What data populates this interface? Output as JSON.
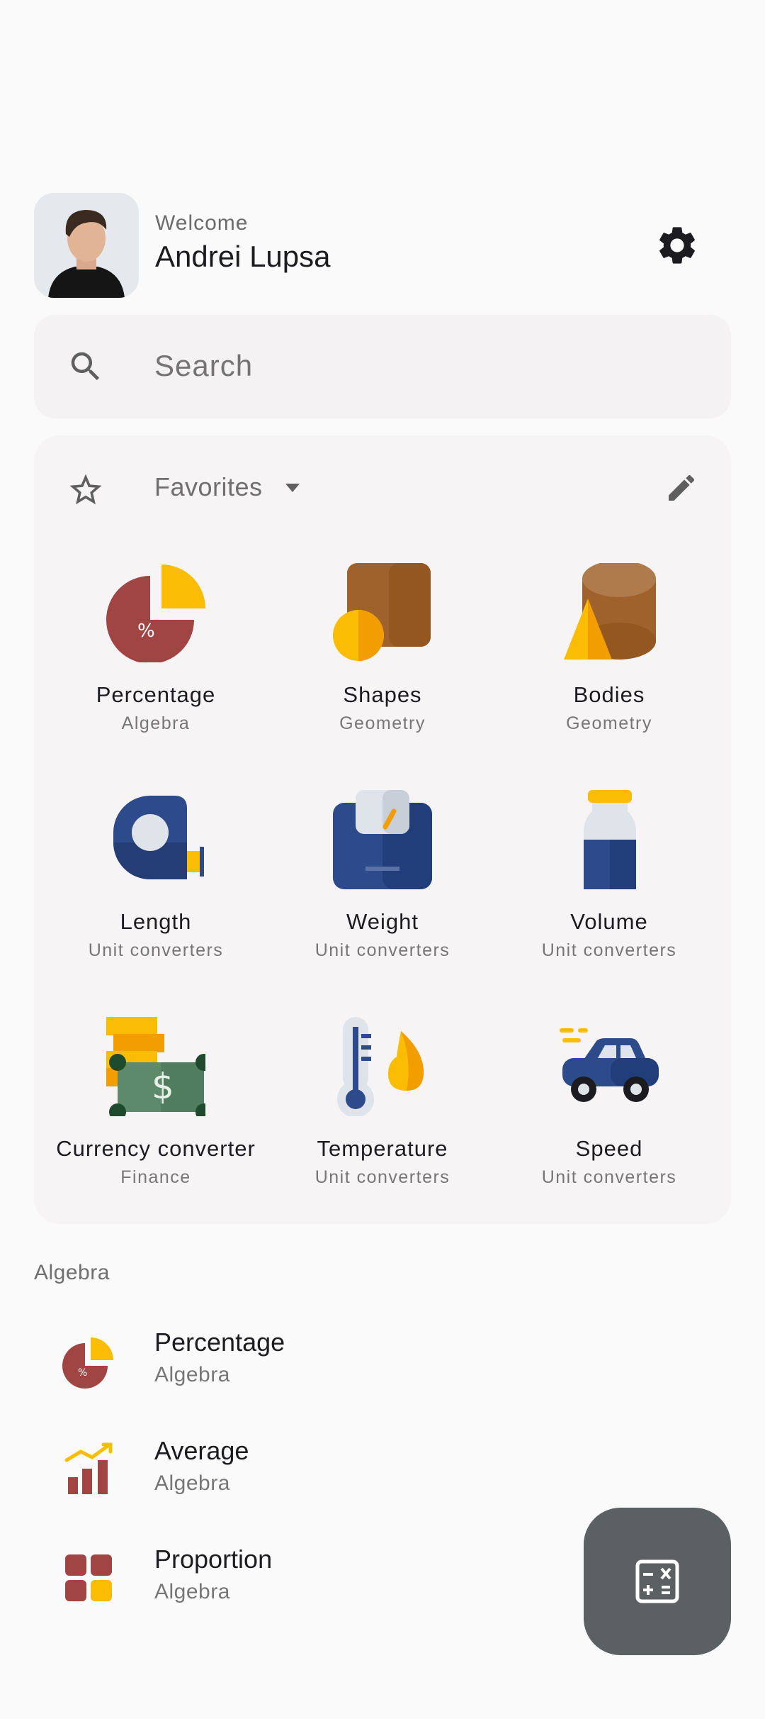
{
  "header": {
    "welcome": "Welcome",
    "user_name": "Andrei Lupsa",
    "avatar_icon": "user-avatar-photo",
    "settings_icon": "gear-icon"
  },
  "search": {
    "placeholder": "Search",
    "icon": "search-icon"
  },
  "favorites": {
    "title": "Favorites",
    "star_icon": "star-icon",
    "dropdown_icon": "caret-down-icon",
    "edit_icon": "pencil-icon",
    "tiles": [
      {
        "name": "Percentage",
        "category": "Algebra",
        "icon": "percentage-icon"
      },
      {
        "name": "Shapes",
        "category": "Geometry",
        "icon": "shapes-icon"
      },
      {
        "name": "Bodies",
        "category": "Geometry",
        "icon": "bodies-icon"
      },
      {
        "name": "Length",
        "category": "Unit converters",
        "icon": "tape-measure-icon"
      },
      {
        "name": "Weight",
        "category": "Unit converters",
        "icon": "weight-icon"
      },
      {
        "name": "Volume",
        "category": "Unit converters",
        "icon": "bottle-icon"
      },
      {
        "name": "Currency converter",
        "category": "Finance",
        "icon": "money-icon"
      },
      {
        "name": "Temperature",
        "category": "Unit converters",
        "icon": "thermometer-icon"
      },
      {
        "name": "Speed",
        "category": "Unit converters",
        "icon": "car-icon"
      }
    ]
  },
  "algebra_section": {
    "label": "Algebra",
    "items": [
      {
        "name": "Percentage",
        "category": "Algebra",
        "icon": "percentage-icon"
      },
      {
        "name": "Average",
        "category": "Algebra",
        "icon": "bar-chart-icon"
      },
      {
        "name": "Proportion",
        "category": "Algebra",
        "icon": "grid-icon"
      }
    ]
  },
  "fab": {
    "icon": "calculator-icon"
  },
  "colors": {
    "background": "#fbfafa",
    "card": "#f6f4f4",
    "fab": "#5b6062",
    "red": "#a14444",
    "yellow": "#fbbc04",
    "navy": "#2d4a8a"
  }
}
